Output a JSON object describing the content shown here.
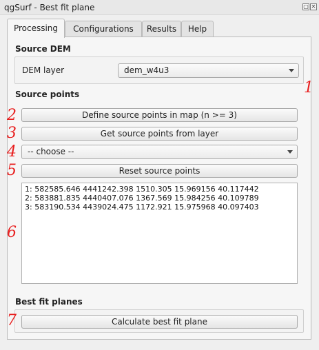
{
  "window": {
    "title": "qgSurf - Best fit plane",
    "float_glyph": "▢",
    "close_glyph": "✕"
  },
  "tabs": [
    {
      "label": "Processing",
      "active": true
    },
    {
      "label": "Configurations",
      "active": false
    },
    {
      "label": "Results",
      "active": false
    },
    {
      "label": "Help",
      "active": false
    }
  ],
  "source_dem": {
    "title": "Source DEM",
    "layer_label": "DEM layer",
    "layer_value": "dem_w4u3"
  },
  "source_points": {
    "title": "Source points",
    "define_button": "Define source points in map (n >= 3)",
    "get_button": "Get source points from layer",
    "layer_combo_value": "-- choose  --",
    "reset_button": "Reset source points",
    "points": [
      "1: 582585.646 4441242.398 1510.305 15.969156 40.117442",
      "2: 583881.835 4440407.076 1367.569 15.984256 40.109789",
      "3: 583190.534 4439024.475 1172.921 15.975968 40.097403"
    ]
  },
  "best_fit": {
    "title": "Best fit planes",
    "calculate_button": "Calculate best fit plane"
  },
  "annotations": [
    "1",
    "2",
    "3",
    "4",
    "5",
    "6",
    "7"
  ],
  "icons": {
    "combo_arrow": "chevron-down-icon"
  },
  "colors": {
    "annotation": "#e81e1e",
    "background": "#efefef"
  }
}
